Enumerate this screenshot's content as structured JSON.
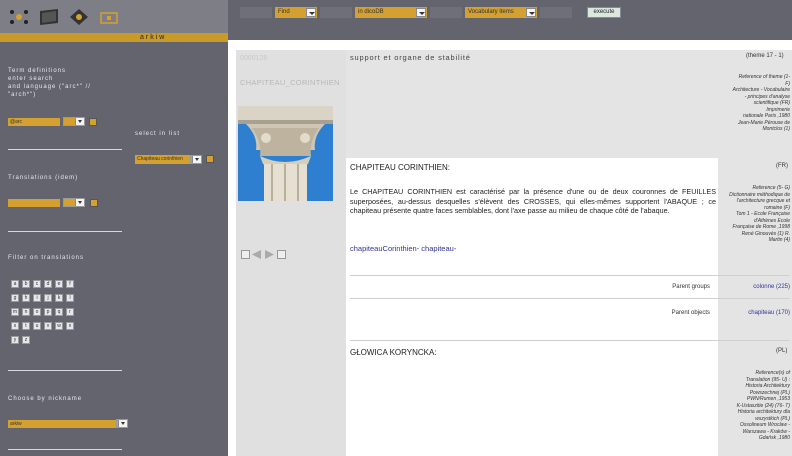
{
  "topbar": {
    "find_label": "Find",
    "db_label": "in dicoDB",
    "vocab_label": "Vocabulary items",
    "execute_label": "execute",
    "brand": "arkiw"
  },
  "sidebar": {
    "term_definitions_lines": [
      "Term definitions",
      "enter search",
      "and language (\"arc*\" //",
      "\"arch*\")"
    ],
    "search_value": "@arc",
    "select_in_list": "select in list",
    "list_value": "Chapiteau corinthien",
    "translations_label": "Translations (idem)",
    "filter_label": "Filter on translations",
    "keys": [
      "a",
      "b",
      "c",
      "d",
      "e",
      "f",
      "g",
      "h",
      "i",
      "j",
      "k",
      "l",
      "m",
      "n",
      "o",
      "p",
      "q",
      "r",
      "s",
      "t",
      "u",
      "v",
      "w",
      "x",
      "y",
      "z"
    ],
    "nickname_label": "Choose by nickname",
    "nickname_value": "arkiw"
  },
  "main": {
    "record_id": "0000128",
    "image_caption": "CHAPITEAU_CORINTHIEN",
    "theme_text": "support et organe de stabilité",
    "theme_ref": "(theme 17 - 1)",
    "theme_source_lines": [
      "Reference of theme (1-",
      "F)",
      "Architecture - Vocabulaire",
      "- principes d'analyse",
      "scientifique (FR)",
      "Imprimerie",
      "nationale Paris ,1980",
      "Jean-Marie Pérouse de",
      "Montclos (1)"
    ],
    "fr_title": "CHAPITEAU CORINTHIEN:",
    "fr_lang": "(FR)",
    "fr_definition": "Le CHAPITEAU CORINTHIEN est caractérisé par la présence d'une ou de deux couronnes de FEUILLES superposées, au-dessus desquelles s'élèvent des CROSSES, qui elles-mêmes supportent l'ABAQUE ; ce chapiteau présente quatre faces semblables, dont l'axe passe au milieu de chaque côté de l'abaque.",
    "fr_links": "chapiteauCorinthien- chapiteau-",
    "fr_source_lines": [
      "Reference (5- G)",
      "Dictionnaire méthodique de",
      "l'architecture grecque et",
      "romaine (F)",
      "Tom 1 - Ecole Française",
      "d'Athènes Ecole",
      "Française de Rome ,1998",
      "René Ginouvès (1) R.",
      "Martin (4)"
    ],
    "parent_groups_label": "Parent groups",
    "parent_groups_value": "colonne (225)",
    "parent_objects_label": "Parent objects",
    "parent_objects_value": "chapiteau (170)",
    "pl_title": "GŁOWICA KORYNCKA:",
    "pl_lang": "(PL)",
    "pl_source_lines": [
      "Reference(s) of",
      "Translation (95- U) :",
      "Historia Architektury",
      "Powszechnej (PL)",
      "PWN/Rumen ,1953",
      "K-Ustaszitie (24) (76- T)",
      "Historia architektury dla",
      "wszystkich (PL)",
      "Ossolineum Wroclaw -",
      "Warszawa - Kraków -",
      "Gdańsk ,1980"
    ]
  },
  "colors": {
    "accent": "#d4a030",
    "sidebar": "#64646e",
    "link": "#333399"
  }
}
